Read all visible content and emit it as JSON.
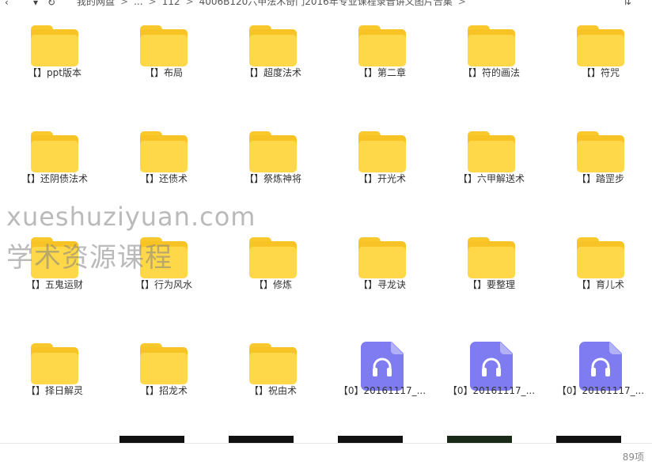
{
  "topbar": {
    "back_icon": "chevron-left",
    "forward_icon": "chevron-down",
    "refresh_icon": "refresh",
    "breadcrumb": [
      "我的网盘",
      "...",
      "112",
      "4006B120六甲法术奇门2016年专业课程录音讲义图片合集"
    ],
    "breadcrumb_separator": ">",
    "sort_icon": "sort"
  },
  "items": [
    {
      "label": "【】ppt版本",
      "type": "folder"
    },
    {
      "label": "【】布局",
      "type": "folder"
    },
    {
      "label": "【】超度法术",
      "type": "folder"
    },
    {
      "label": "【】第二章",
      "type": "folder"
    },
    {
      "label": "【】符的画法",
      "type": "folder"
    },
    {
      "label": "【】符咒",
      "type": "folder"
    },
    {
      "label": "【】还阴债法术",
      "type": "folder"
    },
    {
      "label": "【】还债术",
      "type": "folder"
    },
    {
      "label": "【】祭炼神将",
      "type": "folder"
    },
    {
      "label": "【】开光术",
      "type": "folder"
    },
    {
      "label": "【】六甲解送术",
      "type": "folder"
    },
    {
      "label": "【】踏罡步",
      "type": "folder"
    },
    {
      "label": "【】五鬼运财",
      "type": "folder"
    },
    {
      "label": "【】行为风水",
      "type": "folder"
    },
    {
      "label": "【】修炼",
      "type": "folder"
    },
    {
      "label": "【】寻龙诀",
      "type": "folder"
    },
    {
      "label": "【】要整理",
      "type": "folder"
    },
    {
      "label": "【】育儿术",
      "type": "folder"
    },
    {
      "label": "【】择日解灵",
      "type": "folder"
    },
    {
      "label": "【】招龙术",
      "type": "folder"
    },
    {
      "label": "【】祝由术",
      "type": "folder"
    },
    {
      "label": "【0】20161117_...",
      "type": "audio"
    },
    {
      "label": "【0】20161117_...",
      "type": "audio"
    },
    {
      "label": "【0】20161117_...",
      "type": "audio"
    }
  ],
  "footer": {
    "count": "89项"
  },
  "watermark": {
    "line1": "xueshuziyuan.com",
    "line2": "学术资源课程"
  },
  "colors": {
    "folder": "#ffd84a",
    "audio": "#7f7cf2",
    "background": "#ffffff"
  }
}
